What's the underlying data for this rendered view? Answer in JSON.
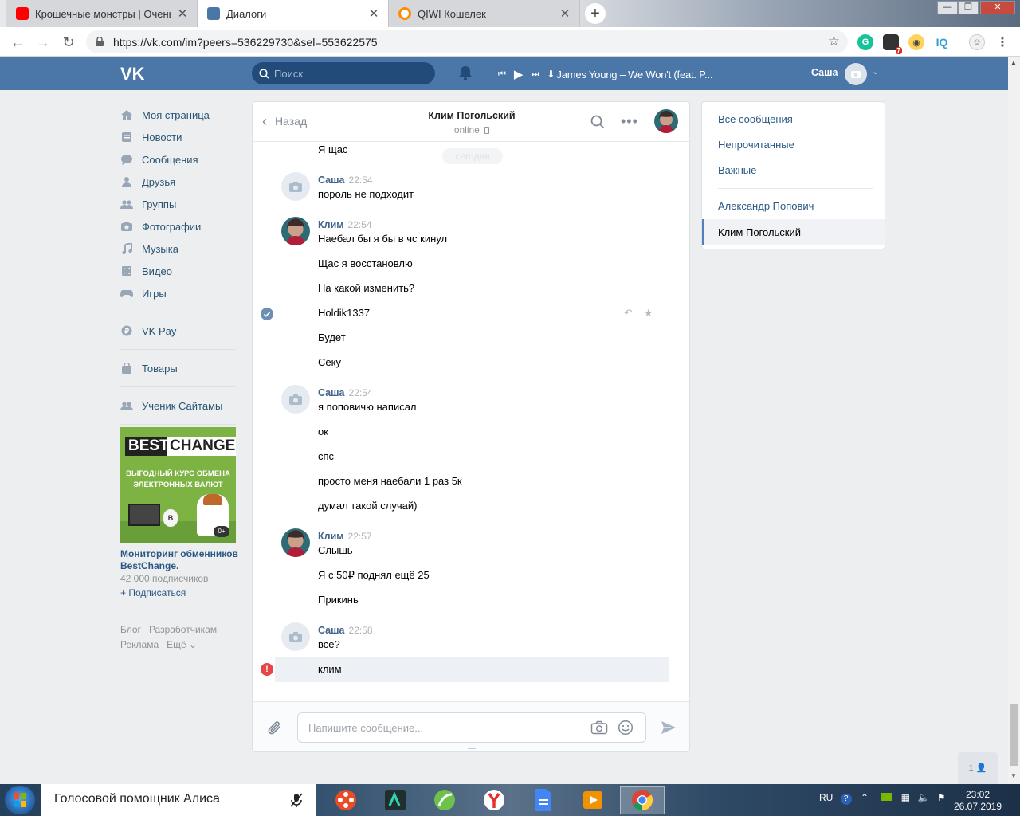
{
  "browser": {
    "tabs": [
      {
        "title": "Крошечные монстры | Очень м",
        "favicon": "youtube-icon",
        "active": false
      },
      {
        "title": "Диалоги",
        "favicon": "vk-chat-icon",
        "active": true
      },
      {
        "title": "QIWI Кошелек",
        "favicon": "qiwi-icon",
        "active": false
      }
    ],
    "url": "https://vk.com/im?peers=536229730&sel=553622575"
  },
  "vk_header": {
    "search_placeholder": "Поиск",
    "now_playing": "James Young – We Won't (feat. P...",
    "user_name": "Саша"
  },
  "left_menu": {
    "items": [
      {
        "label": "Моя страница",
        "icon": "home-icon"
      },
      {
        "label": "Новости",
        "icon": "news-icon"
      },
      {
        "label": "Сообщения",
        "icon": "messages-icon"
      },
      {
        "label": "Друзья",
        "icon": "friend-icon"
      },
      {
        "label": "Группы",
        "icon": "groups-icon"
      },
      {
        "label": "Фотографии",
        "icon": "camera-icon"
      },
      {
        "label": "Музыка",
        "icon": "music-icon"
      },
      {
        "label": "Видео",
        "icon": "video-icon"
      },
      {
        "label": "Игры",
        "icon": "gamepad-icon"
      }
    ],
    "vkpay": "VK Pay",
    "goods": "Товары",
    "community": "Ученик Сайтамы",
    "ad": {
      "banner_brand_a": "BEST",
      "banner_brand_b": "CHANGE",
      "banner_line1": "ВЫГОДНЫЙ КУРС ОБМЕНА",
      "banner_line2": "ЭЛЕКТРОННЫХ ВАЛЮТ",
      "badge": "0+",
      "coin": "B",
      "title": "Мониторинг обменников BestChange.",
      "subscribers": "42 000 подписчиков",
      "subscribe": "+ Подписаться"
    },
    "footer": {
      "blog": "Блог",
      "devs": "Разработчикам",
      "ads": "Реклама",
      "more": "Ещё ⌄"
    }
  },
  "chat": {
    "back": "Назад",
    "peer_name": "Клим Погольский",
    "peer_status": "online",
    "date_pill": "сегодня",
    "input_placeholder": "Напишите сообщение...",
    "messages": [
      {
        "text": "Я щас"
      },
      {
        "author": "Саша",
        "time": "22:54",
        "text": "пороль не подходит"
      },
      {
        "author": "Клим",
        "time": "22:54",
        "text": "Наебал бы я бы в чс кинул"
      },
      {
        "text": "Щас я восстановлю"
      },
      {
        "text": "На какой изменить?"
      },
      {
        "text": "Holdik1337"
      },
      {
        "text": "Будет"
      },
      {
        "text": "Секу"
      },
      {
        "author": "Саша",
        "time": "22:54",
        "text": "я поповичю написал"
      },
      {
        "text": "ок"
      },
      {
        "text": "спс"
      },
      {
        "text": "просто меня наебали 1 раз 5к"
      },
      {
        "text": "думал такой случай)"
      },
      {
        "author": "Клим",
        "time": "22:57",
        "text": "Слышь"
      },
      {
        "text": "Я с 50₽ поднял ещё 25"
      },
      {
        "text": "Прикинь"
      },
      {
        "author": "Саша",
        "time": "22:58",
        "text": "все?"
      },
      {
        "text": "клим"
      }
    ]
  },
  "right_panel": {
    "all": "Все сообщения",
    "unread": "Непрочитанные",
    "important": "Важные",
    "conv1": "Александр Попович",
    "conv2": "Клим Погольский"
  },
  "online_count": "1",
  "taskbar": {
    "assistant": "Голосовой помощник Алиса",
    "lang": "RU",
    "time": "23:02",
    "date": "26.07.2019"
  }
}
